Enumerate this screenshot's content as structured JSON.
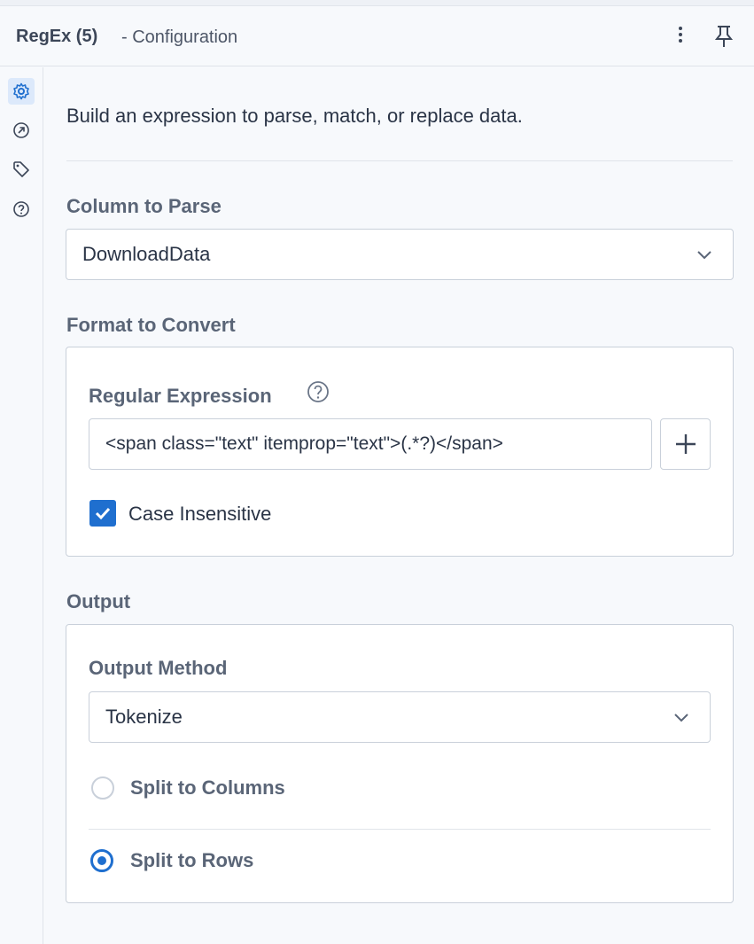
{
  "header": {
    "title": "RegEx (5)",
    "subtitle": "- Configuration",
    "more_icon": "more-vertical-icon",
    "pin_icon": "pin-icon"
  },
  "rail": [
    {
      "icon": "gear-icon",
      "active": true
    },
    {
      "icon": "arrow-circle-icon",
      "active": false
    },
    {
      "icon": "tag-icon",
      "active": false
    },
    {
      "icon": "help-circle-icon",
      "active": false
    }
  ],
  "intro": "Build an expression to parse, match, or replace data.",
  "column_to_parse": {
    "label": "Column to Parse",
    "value": "DownloadData"
  },
  "format_to_convert": {
    "label": "Format to Convert",
    "regex_label": "Regular Expression",
    "regex_value": "<span class=\"text\" itemprop=\"text\">(.*?)</span>",
    "case_insensitive_label": "Case Insensitive",
    "case_insensitive": true
  },
  "output": {
    "label": "Output",
    "method_label": "Output Method",
    "method_value": "Tokenize",
    "options": [
      {
        "label": "Split to Columns",
        "selected": false
      },
      {
        "label": "Split to Rows",
        "selected": true
      }
    ]
  },
  "colors": {
    "accent": "#1f6fcf",
    "border": "#c9d0da",
    "background": "#f7f9fc"
  }
}
